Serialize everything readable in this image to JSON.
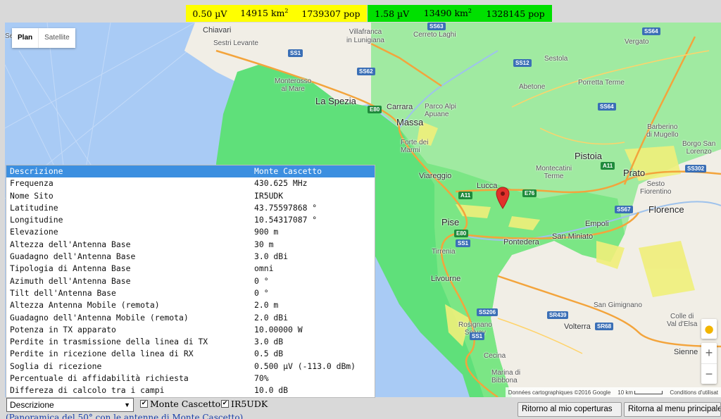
{
  "legend": {
    "yellow": {
      "level": "0.50 µV",
      "area": "14915 km",
      "area_exp": "2",
      "pop": "1739307 pop",
      "color": "#ffff00"
    },
    "green": {
      "level": "1.58 µV",
      "area": "13490 km",
      "area_exp": "2",
      "pop": "1328145 pop",
      "color": "#00e000"
    }
  },
  "map": {
    "type_buttons": {
      "plan": "Plan",
      "satellite": "Satellite"
    },
    "places": {
      "chiavari": "Chiavari",
      "sestri": "Sestri Levante",
      "villafranca": "Villafranca\nin Lunigiana",
      "cerreto": "Cerreto Laghi",
      "vergato": "Vergato",
      "sestola": "Sestola",
      "abetone": "Abetone",
      "porretta": "Porretta Terme",
      "monterosso": "Monterosso\nal Mare",
      "laspezia": "La Spezia",
      "carrara": "Carrara",
      "parco": "Parco Alpi\nApuane",
      "massa": "Massa",
      "barberino": "Barberino\ndi Mugello",
      "borgo": "Borgo San\nLorenzo",
      "forte": "Forte dei\nMarmi",
      "pistoia": "Pistoia",
      "montecatini": "Montecatini\nTerme",
      "prato": "Prato",
      "sesto": "Sesto\nFiorentino",
      "viareggio": "Viareggio",
      "lucca": "Lucca",
      "florence": "Florence",
      "empoli": "Empoli",
      "pise": "Pise",
      "sanminiato": "San Miniato",
      "pontedera": "Pontedera",
      "tirrenia": "Tirrenia",
      "livourne": "Livourne",
      "sangimignano": "San Gimignano",
      "colle": "Colle di\nVal d'Elsa",
      "rosignano": "Rosignano\nSolvay",
      "volterra": "Volterra",
      "sienne": "Sienne",
      "cecina": "Cecina",
      "marina": "Marina di\nBibbona",
      "sa": "Se"
    },
    "shields": [
      "SS63",
      "SS64",
      "SS12",
      "SS1",
      "SS62",
      "SS64",
      "E80",
      "A11",
      "E76",
      "A11",
      "SS302",
      "SS67",
      "E80",
      "SS1",
      "SS206",
      "SR439",
      "SR68",
      "SS1"
    ],
    "attribution": {
      "data": "Données cartographiques ©2016 Google",
      "scale": "10 km",
      "terms": "Conditions d'utilisat"
    },
    "zoom": {
      "in": "+",
      "out": "−"
    }
  },
  "info_table": {
    "header": {
      "label": "Descrizione",
      "value": "Monte Cascetto"
    },
    "rows": [
      {
        "label": "Frequenza",
        "value": "430.625 MHz"
      },
      {
        "label": "Nome Sito",
        "value": "IR5UDK"
      },
      {
        "label": "Latitudine",
        "value": "43.75597868 °"
      },
      {
        "label": "Longitudine",
        "value": "10.54317087 °"
      },
      {
        "label": "Elevazione",
        "value": "900 m"
      },
      {
        "label": "Altezza dell'Antenna Base",
        "value": "30 m"
      },
      {
        "label": "Guadagno dell'Antenna Base",
        "value": "3.0 dBi"
      },
      {
        "label": "Tipologia di Antenna Base",
        "value": "omni"
      },
      {
        "label": "Azimuth dell'Antenna Base",
        "value": "0 °"
      },
      {
        "label": "Tilt dell'Antenna Base",
        "value": "0 °"
      },
      {
        "label": "Altezza Antenna Mobile (remota)",
        "value": "2.0 m"
      },
      {
        "label": "Guadagno dell'Antenna Mobile (remota)",
        "value": "2.0 dBi"
      },
      {
        "label": "Potenza in TX apparato",
        "value": "10.00000 W"
      },
      {
        "label": "Perdite in trasmissione della linea di TX",
        "value": "3.0 dB"
      },
      {
        "label": "Perdite in ricezione della linea di RX",
        "value": "0.5 dB"
      },
      {
        "label": "Soglia di ricezione",
        "value": "0.500 µV (-113.0 dBm)"
      },
      {
        "label": "Percentuale di affidabilità richiesta",
        "value": "70%"
      },
      {
        "label": "Differeza di calcolo tra i campi",
        "value": "10.0 dB"
      }
    ]
  },
  "controls": {
    "select_value": "Descrizione",
    "check_site": "Monte Cascetto",
    "check_call": "IR5UDK",
    "link": "(Panoramica del 50° con le antenne di Monte Cascetto)",
    "btn_coverage": "Ritorno al mio coperturas",
    "btn_menu": "Ritorna al menu principale"
  }
}
